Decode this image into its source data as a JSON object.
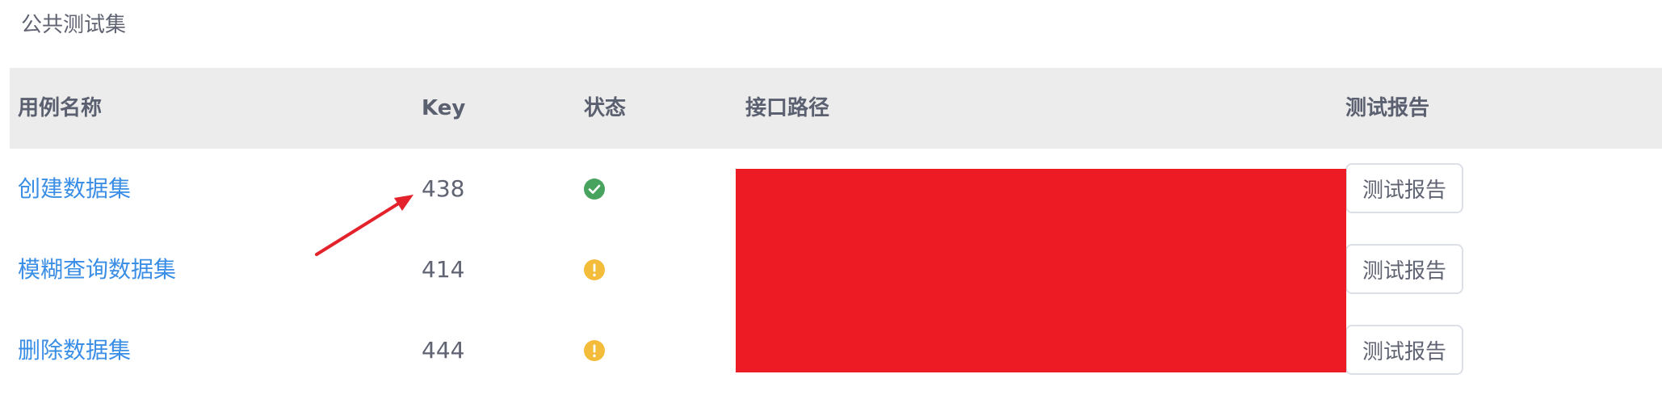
{
  "section": {
    "title": "公共测试集"
  },
  "table": {
    "headers": {
      "name": "用例名称",
      "key": "Key",
      "status": "状态",
      "path": "接口路径",
      "report": "测试报告"
    },
    "rows": [
      {
        "name": "创建数据集",
        "key": "438",
        "status": "success",
        "status_icon": "check-circle-icon",
        "status_color": "#48a35e",
        "report_label": "测试报告"
      },
      {
        "name": "模糊查询数据集",
        "key": "414",
        "status": "warning",
        "status_icon": "exclamation-circle-icon",
        "status_color": "#f3bd3b",
        "report_label": "测试报告"
      },
      {
        "name": "删除数据集",
        "key": "444",
        "status": "warning",
        "status_icon": "exclamation-circle-icon",
        "status_color": "#f3bd3b",
        "report_label": "测试报告"
      }
    ]
  },
  "colors": {
    "link": "#3a8ee6",
    "header_bg": "#ececec",
    "redaction": "#ed1c24",
    "annotation_arrow": "#e3222b"
  }
}
